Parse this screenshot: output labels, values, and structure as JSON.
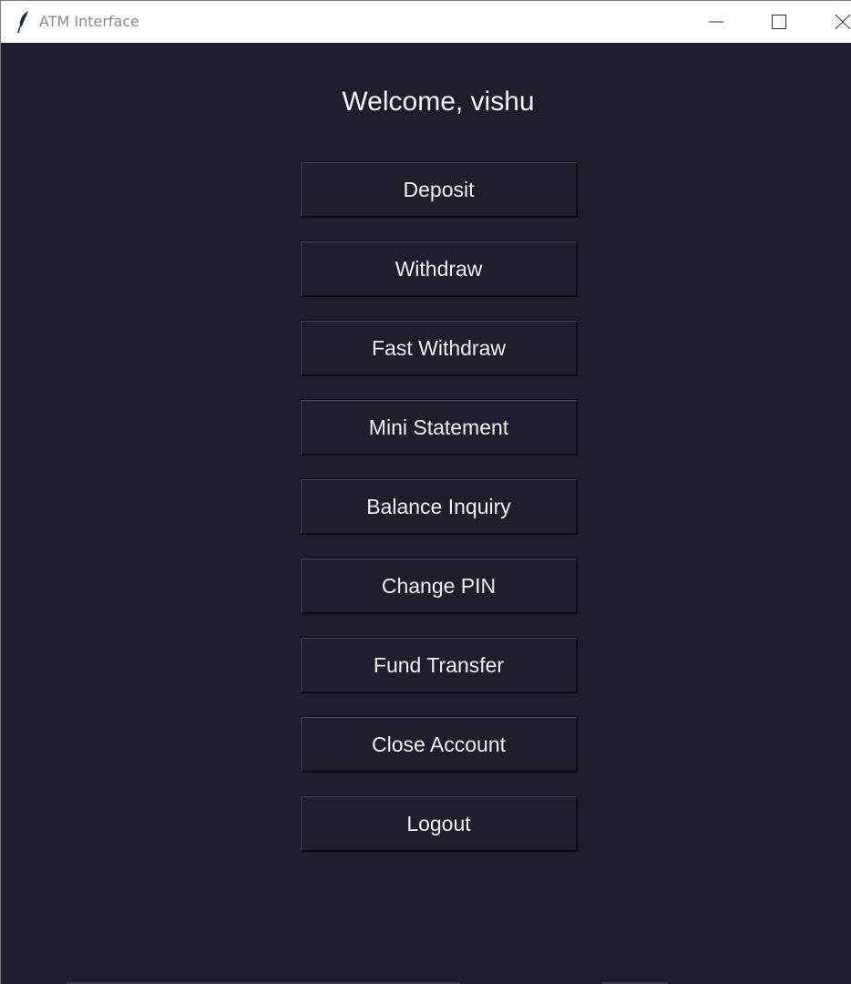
{
  "window": {
    "title": "ATM Interface",
    "icon": "feather-icon",
    "controls": [
      "minimize-icon",
      "maximize-icon",
      "close-icon"
    ]
  },
  "main": {
    "welcome": "Welcome, vishu",
    "buttons": [
      {
        "label": "Deposit"
      },
      {
        "label": "Withdraw"
      },
      {
        "label": "Fast Withdraw"
      },
      {
        "label": "Mini Statement"
      },
      {
        "label": "Balance Inquiry"
      },
      {
        "label": "Change PIN"
      },
      {
        "label": "Fund Transfer"
      },
      {
        "label": "Close Account"
      },
      {
        "label": "Logout"
      }
    ]
  },
  "colors": {
    "background": "#1f1e2c",
    "text": "#f0f0f0",
    "titlebar": "#ffffff"
  }
}
